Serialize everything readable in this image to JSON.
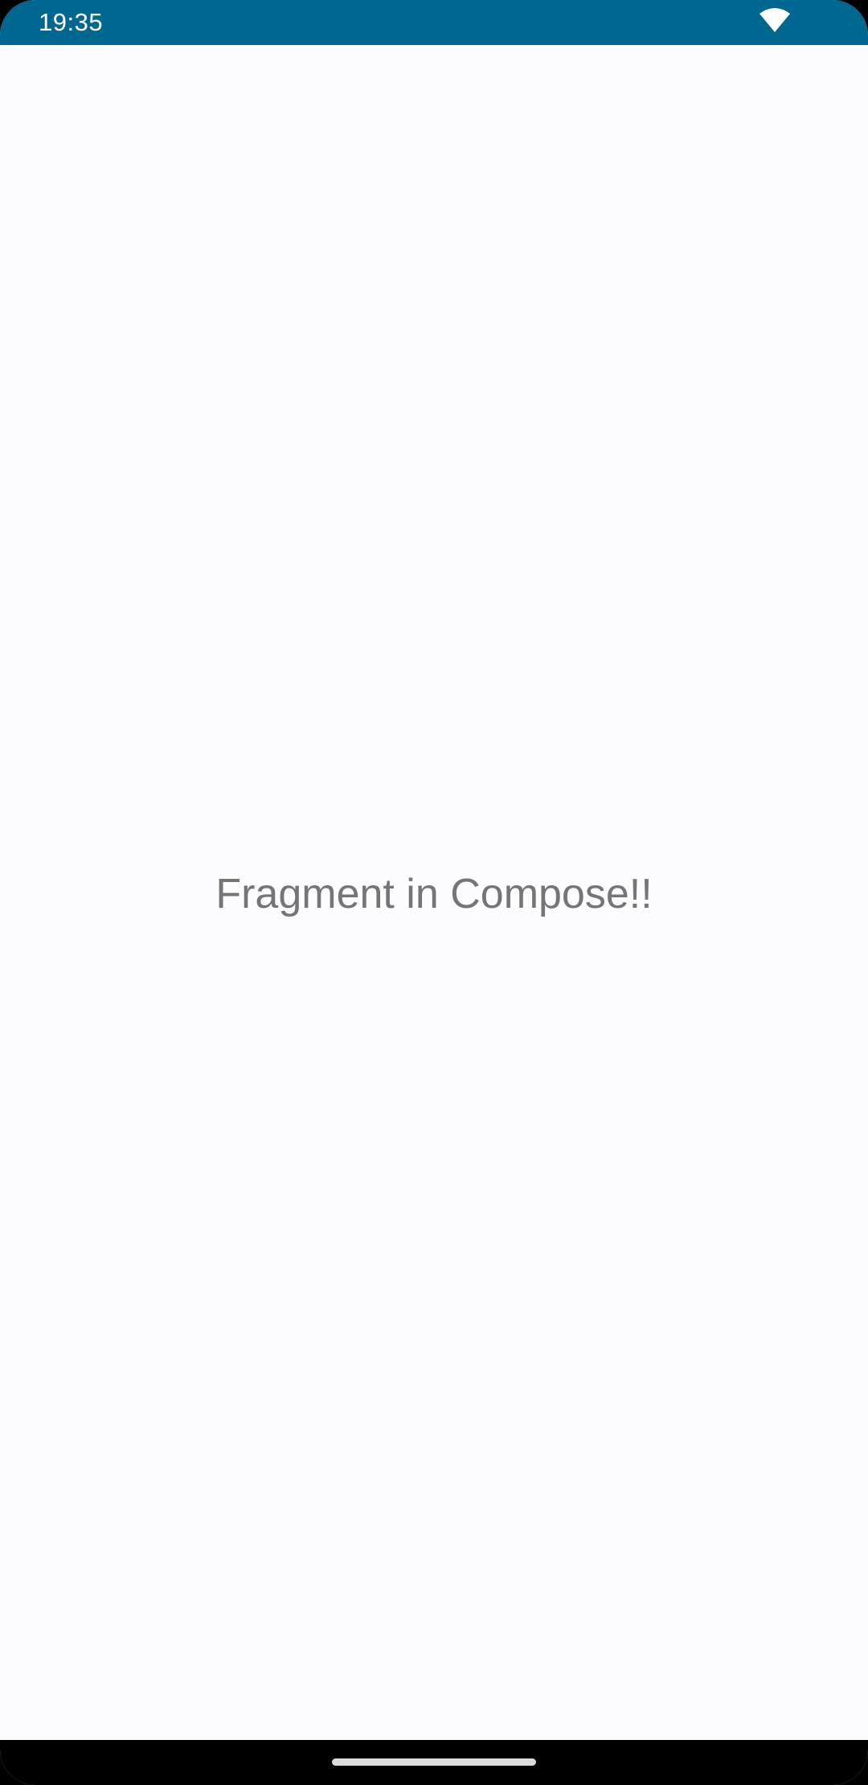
{
  "status_bar": {
    "time": "19:35",
    "wifi_icon": "wifi-icon",
    "color": "#006791"
  },
  "content": {
    "message": "Fragment in Compose!!"
  },
  "nav_bar": {
    "handle_icon": "gesture-handle"
  }
}
